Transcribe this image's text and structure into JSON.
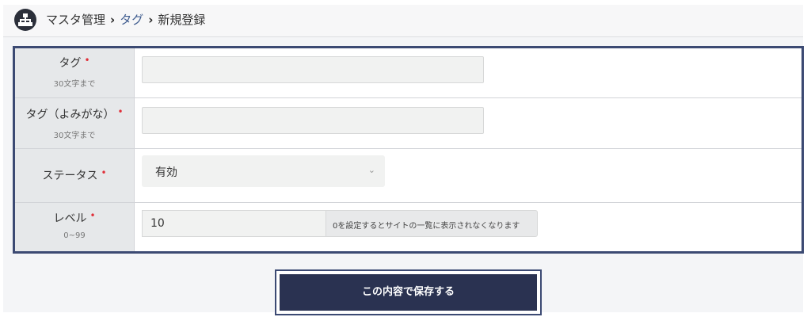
{
  "header": {
    "breadcrumb": [
      "マスタ管理",
      "タグ",
      "新規登録"
    ],
    "icon": "sitemap-icon"
  },
  "form": {
    "rows": [
      {
        "label": "タグ",
        "sub": "30文字まで",
        "required": "•",
        "value": ""
      },
      {
        "label": "タグ（よみがな）",
        "sub": "30文字まで",
        "required": "•",
        "value": ""
      },
      {
        "label": "ステータス",
        "required": "•",
        "selected": "有効"
      },
      {
        "label": "レベル",
        "sub": "0~99",
        "required": "•",
        "value": "10",
        "hint": "0を設定するとサイトの一覧に表示されなくなります"
      }
    ]
  },
  "actions": {
    "save_label": "この内容で保存する"
  },
  "colors": {
    "accent": "#2a3251",
    "frame": "#3c4a73",
    "required": "#e0303a",
    "link": "#3f5c8f"
  }
}
